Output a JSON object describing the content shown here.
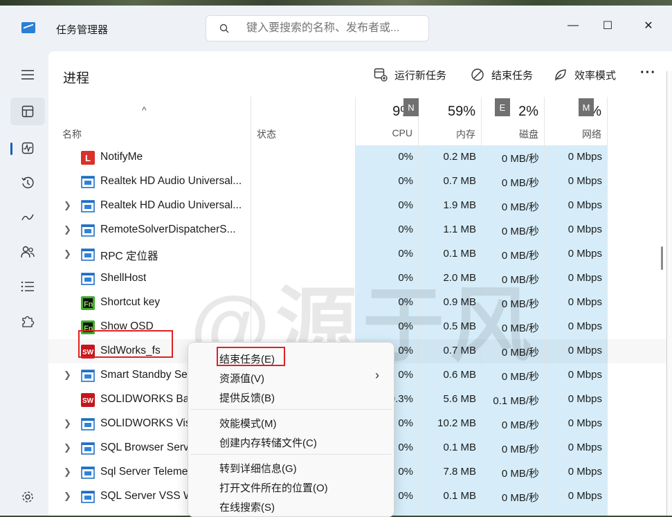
{
  "window": {
    "title": "任务管理器",
    "search_placeholder": "键入要搜索的名称、发布者或...",
    "minimize_label": "—",
    "maximize_label": "☐",
    "close_label": "✕"
  },
  "nav": {
    "items": [
      "menu-icon",
      "processes-icon",
      "performance-icon",
      "app-history-icon",
      "startup-apps-icon",
      "users-icon",
      "details-icon",
      "services-icon"
    ],
    "settings": "settings-icon"
  },
  "page": {
    "title": "进程",
    "run_new_task": "运行新任务",
    "end_task": "结束任务",
    "efficiency_mode": "效率模式",
    "more": "···"
  },
  "columns": {
    "sort_arrow": "^",
    "name": "名称",
    "status": "状态",
    "cpu": {
      "pct": "9%",
      "label": "CPU",
      "badge": "N"
    },
    "memory": {
      "pct": "59%",
      "label": "内存"
    },
    "disk": {
      "pct": "2%",
      "label": "磁盘",
      "badge": "E"
    },
    "network": {
      "pct": "%",
      "label": "网络",
      "badge": "M"
    }
  },
  "processes": [
    {
      "name": "NotifyMe",
      "expand": false,
      "icon": "notifyme-icon",
      "cpu": "0%",
      "mem": "0.2 MB",
      "disk": "0 MB/秒",
      "net": "0 Mbps"
    },
    {
      "name": "Realtek HD Audio Universal...",
      "expand": false,
      "icon": "window-app-icon",
      "cpu": "0%",
      "mem": "0.7 MB",
      "disk": "0 MB/秒",
      "net": "0 Mbps"
    },
    {
      "name": "Realtek HD Audio Universal...",
      "expand": true,
      "icon": "window-app-icon",
      "cpu": "0%",
      "mem": "1.9 MB",
      "disk": "0 MB/秒",
      "net": "0 Mbps"
    },
    {
      "name": "RemoteSolverDispatcherS...",
      "expand": true,
      "icon": "window-app-icon",
      "cpu": "0%",
      "mem": "1.1 MB",
      "disk": "0 MB/秒",
      "net": "0 Mbps"
    },
    {
      "name": "RPC 定位器",
      "expand": true,
      "icon": "window-app-icon",
      "cpu": "0%",
      "mem": "0.1 MB",
      "disk": "0 MB/秒",
      "net": "0 Mbps"
    },
    {
      "name": "ShellHost",
      "expand": false,
      "icon": "window-app-icon",
      "cpu": "0%",
      "mem": "2.0 MB",
      "disk": "0 MB/秒",
      "net": "0 Mbps"
    },
    {
      "name": "Shortcut key",
      "expand": false,
      "icon": "fn-key-icon",
      "cpu": "0%",
      "mem": "0.9 MB",
      "disk": "0 MB/秒",
      "net": "0 Mbps"
    },
    {
      "name": "Show OSD",
      "expand": false,
      "icon": "fn-key-icon",
      "cpu": "0%",
      "mem": "0.5 MB",
      "disk": "0 MB/秒",
      "net": "0 Mbps"
    },
    {
      "name": "SldWorks_fs",
      "expand": false,
      "icon": "solidworks-icon",
      "cpu": "0%",
      "mem": "0.7 MB",
      "disk": "0 MB/秒",
      "net": "0 Mbps"
    },
    {
      "name": "Smart Standby Se",
      "expand": true,
      "icon": "window-app-icon",
      "cpu": "0%",
      "mem": "0.6 MB",
      "disk": "0 MB/秒",
      "net": "0 Mbps"
    },
    {
      "name": "SOLIDWORKS Bac",
      "expand": false,
      "icon": "solidworks-icon",
      "cpu": "0.3%",
      "mem": "5.6 MB",
      "disk": "0.1 MB/秒",
      "net": "0 Mbps"
    },
    {
      "name": "SOLIDWORKS Vis",
      "expand": true,
      "icon": "window-app-icon",
      "cpu": "0%",
      "mem": "10.2 MB",
      "disk": "0 MB/秒",
      "net": "0 Mbps"
    },
    {
      "name": "SQL Browser Serv",
      "expand": true,
      "icon": "window-app-icon",
      "cpu": "0%",
      "mem": "0.1 MB",
      "disk": "0 MB/秒",
      "net": "0 Mbps"
    },
    {
      "name": "Sql Server Teleme",
      "expand": true,
      "icon": "window-app-icon",
      "cpu": "0%",
      "mem": "7.8 MB",
      "disk": "0 MB/秒",
      "net": "0 Mbps"
    },
    {
      "name": "SQL Server VSS W",
      "expand": true,
      "icon": "window-app-icon",
      "cpu": "0%",
      "mem": "0.1 MB",
      "disk": "0 MB/秒",
      "net": "0 Mbps"
    }
  ],
  "context_menu": {
    "end_task": "结束任务(E)",
    "resource_values": "资源值(V)",
    "submenu_arrow": "›",
    "feedback": "提供反馈(B)",
    "efficiency_mode": "效能模式(M)",
    "create_dump": "创建内存转储文件(C)",
    "go_to_details": "转到详细信息(G)",
    "open_file_location": "打开文件所在的位置(O)",
    "search_online": "在线搜索(S)"
  },
  "watermark": "@源于风",
  "colors": {
    "metric_highlight": "#d6edf9",
    "annotation_red": "#e02020"
  }
}
